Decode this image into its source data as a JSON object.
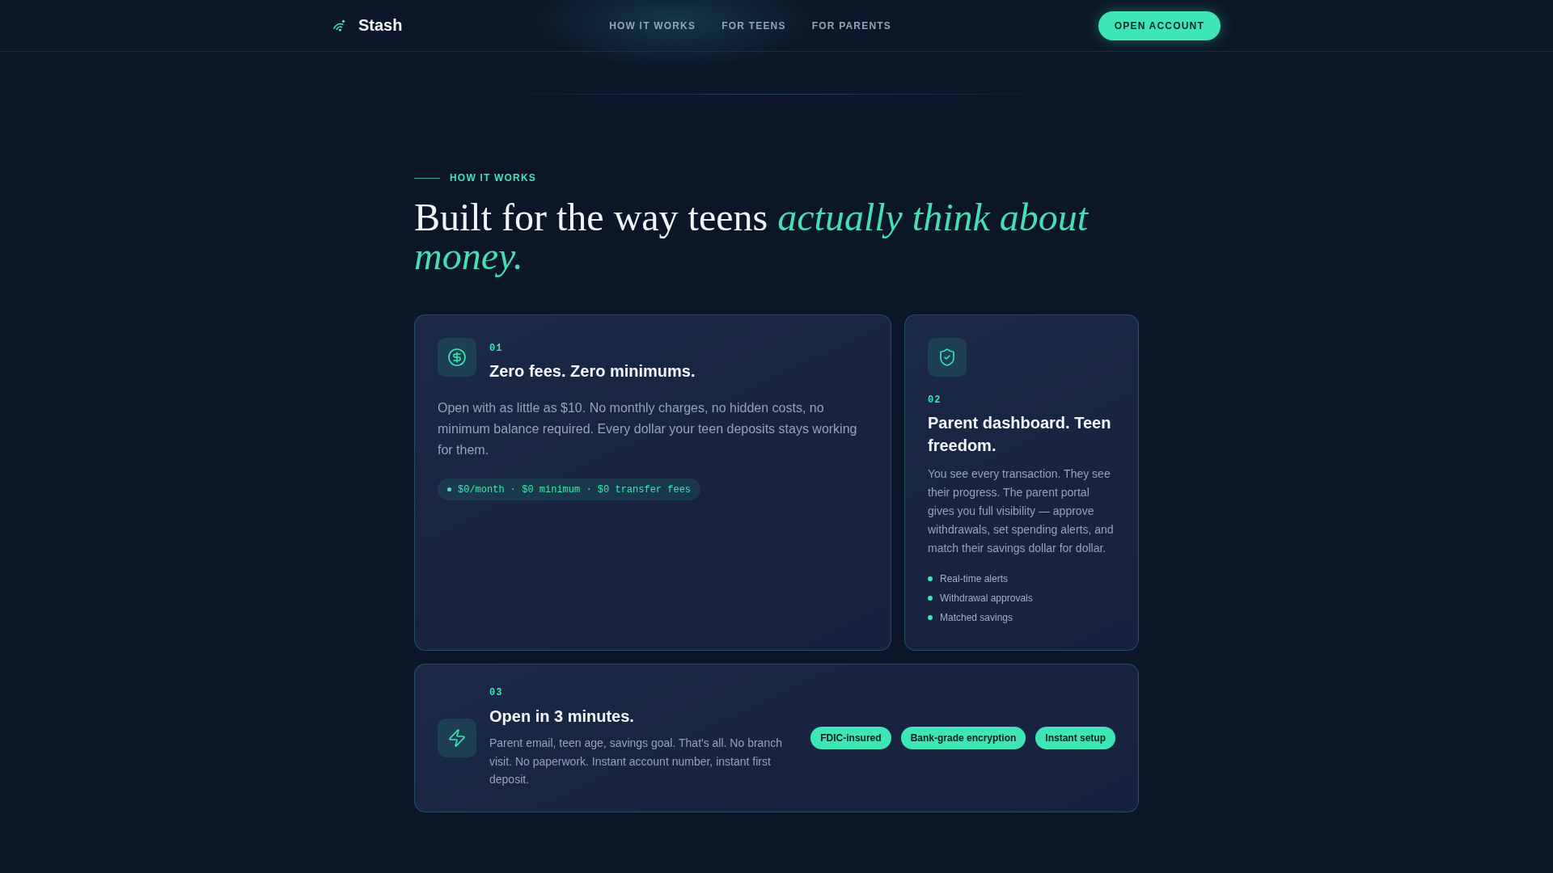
{
  "nav": {
    "brand": "Stash",
    "links": [
      "HOW IT WORKS",
      "FOR TEENS",
      "FOR PARENTS"
    ],
    "cta": "OPEN ACCOUNT"
  },
  "section": {
    "eyebrow": "HOW IT WORKS",
    "heading": "Built for the way teens *actually think about money.*"
  },
  "features": [
    {
      "kind": "wide",
      "number": "01",
      "title": "Zero fees. Zero minimums.",
      "body": "Open with as little as $10. No monthly charges, no hidden costs, no minimum balance required. Every dollar your teen deposits stays working for them.",
      "pill": "$0/month · $0 minimum · $0 transfer fees"
    },
    {
      "kind": "tall",
      "number": "02",
      "title": "Parent dashboard. Teen freedom.",
      "body": "You see every transaction. They see their progress. The parent portal gives you full visibility — approve withdrawals, set spending alerts, and match their savings dollar for dollar.",
      "bullets": [
        "Real-time alerts",
        "Withdrawal approvals",
        "Matched savings"
      ]
    },
    {
      "kind": "banner",
      "number": "03",
      "title": "Open in 3 minutes.",
      "body": "Parent email, teen age, savings goal. That's all. No branch visit. No paperwork. Instant account number, instant first deposit.",
      "tags": [
        "FDIC-insured",
        "Bank-grade encryption",
        "Instant setup"
      ]
    }
  ]
}
